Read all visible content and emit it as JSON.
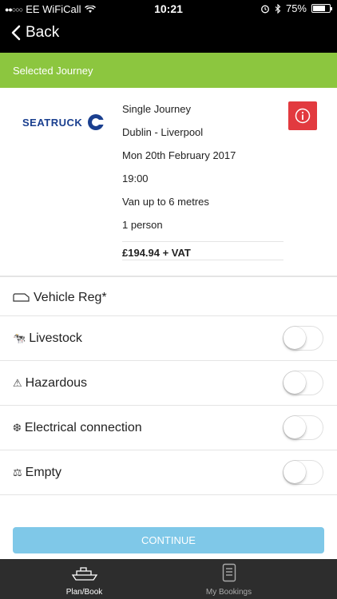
{
  "status_bar": {
    "carrier": "EE WiFiCall",
    "time": "10:21",
    "battery": "75%",
    "battery_level": 0.75
  },
  "nav": {
    "back_label": "Back"
  },
  "section_header": "Selected Journey",
  "journey": {
    "logo_text": "SEATRUCK",
    "type": "Single Journey",
    "route": "Dublin - Liverpool",
    "date": "Mon 20th February 2017",
    "time": "19:00",
    "vehicle": "Van up to 6 metres",
    "passengers": "1 person",
    "price": "£194.94 + VAT"
  },
  "form": {
    "vehicle_reg_label": "Vehicle Reg*",
    "toggles": [
      {
        "label": "Livestock",
        "icon": "livestock-icon",
        "on": false
      },
      {
        "label": "Hazardous",
        "icon": "hazard-icon",
        "on": false
      },
      {
        "label": "Electrical connection",
        "icon": "electrical-icon",
        "on": false
      },
      {
        "label": "Empty",
        "icon": "scales-icon",
        "on": false
      }
    ]
  },
  "continue_label": "CONTINUE",
  "tabs": [
    {
      "label": "Plan/Book",
      "icon": "ship-icon",
      "active": true
    },
    {
      "label": "My Bookings",
      "icon": "bookings-icon",
      "active": false
    }
  ],
  "colors": {
    "accent_green": "#8cc63f",
    "info_red": "#e23a3f",
    "continue_blue": "#7fc8e8",
    "logo_blue": "#1a3f8f"
  }
}
